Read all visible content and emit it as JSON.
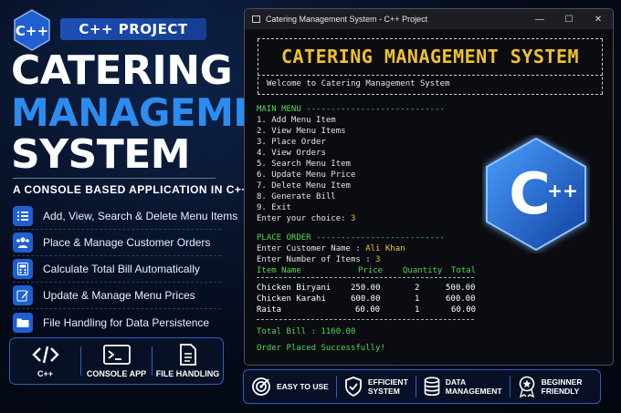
{
  "header": {
    "badge": "C++ PROJECT",
    "logo_text": "C++",
    "title_line1": "CATERING",
    "title_line2": "MANAGEMENT",
    "title_line3": "SYSTEM",
    "subtitle": "A CONSOLE BASED APPLICATION IN C++"
  },
  "features": [
    {
      "icon": "list-icon",
      "label": "Add, View, Search & Delete Menu Items"
    },
    {
      "icon": "users-icon",
      "label": "Place & Manage Customer Orders"
    },
    {
      "icon": "calculator-icon",
      "label": "Calculate Total Bill Automatically"
    },
    {
      "icon": "edit-icon",
      "label": "Update & Manage Menu Prices"
    },
    {
      "icon": "folder-icon",
      "label": "File Handling for Data Persistence"
    }
  ],
  "tech": [
    {
      "icon": "code-icon",
      "label": "C++"
    },
    {
      "icon": "terminal-icon",
      "label": "CONSOLE APP"
    },
    {
      "icon": "file-icon",
      "label": "FILE HANDLING"
    }
  ],
  "window": {
    "title": "Catering Management System - C++ Project",
    "controls": [
      "minimize",
      "maximize",
      "close"
    ]
  },
  "console": {
    "banner": "CATERING MANAGEMENT SYSTEM",
    "welcome": "Welcome to Catering Management System",
    "main_menu_header": "MAIN MENU ----------------------------",
    "menu_items": [
      "1. Add Menu Item",
      "2. View Menu Items",
      "3. Place Order",
      "4. View Orders",
      "5. Search Menu Item",
      "6. Update Menu Price",
      "7. Delete Menu Item",
      "8. Generate Bill",
      "9. Exit"
    ],
    "choice_prompt": "Enter your choice:",
    "choice_value": "3",
    "place_order_header": "PLACE ORDER --------------------------",
    "customer_prompt": "Enter Customer Name :",
    "customer_value": "Ali Khan",
    "items_prompt": "Enter Number of Items :",
    "items_value": "3",
    "table_headers": [
      "Item Name",
      "Price",
      "Quantity",
      "Total"
    ],
    "table_rows": [
      [
        "Chicken Biryani",
        "250.00",
        "2",
        "500.00"
      ],
      [
        "Chicken Karahi",
        "600.00",
        "1",
        "600.00"
      ],
      [
        "Raita",
        "60.00",
        "1",
        "60.00"
      ]
    ],
    "total_bill": "Total Bill : 1160.00",
    "success": "Order Placed Successfully!"
  },
  "big_logo_text": "C",
  "big_logo_plus": "++",
  "bottom_bar": [
    {
      "icon": "target-icon",
      "label1": "EASY TO USE",
      "label2": ""
    },
    {
      "icon": "shield-check-icon",
      "label1": "EFFICIENT",
      "label2": "SYSTEM"
    },
    {
      "icon": "database-icon",
      "label1": "DATA",
      "label2": "MANAGEMENT"
    },
    {
      "icon": "award-icon",
      "label1": "BEGINNER",
      "label2": "FRIENDLY"
    }
  ],
  "colors": {
    "accent_blue": "#2d8cf0",
    "console_green": "#52d84f",
    "console_yellow": "#f2c128"
  }
}
